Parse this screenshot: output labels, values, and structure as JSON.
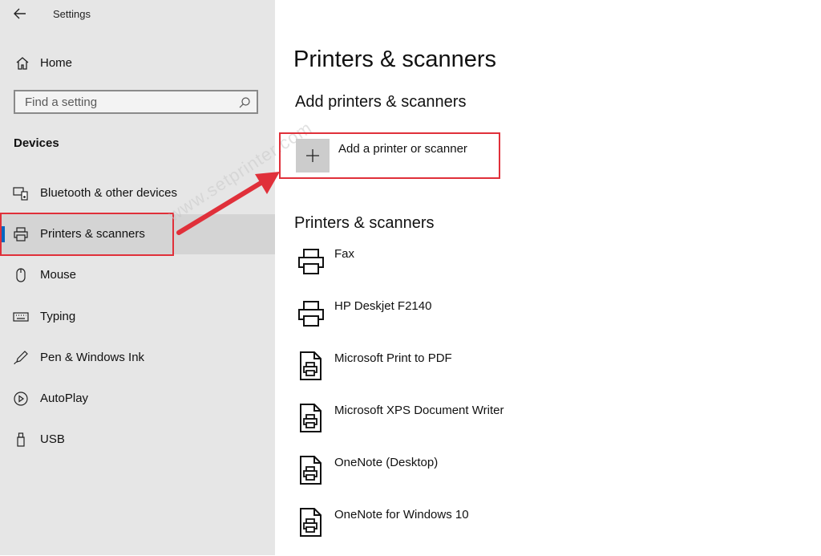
{
  "window": {
    "title": "Settings"
  },
  "sidebar": {
    "home_label": "Home",
    "search_placeholder": "Find a setting",
    "section": "Devices",
    "items": [
      {
        "label": "Bluetooth & other devices",
        "icon": "bluetooth-devices-icon"
      },
      {
        "label": "Printers & scanners",
        "icon": "printer-icon",
        "selected": true
      },
      {
        "label": "Mouse",
        "icon": "mouse-icon"
      },
      {
        "label": "Typing",
        "icon": "keyboard-icon"
      },
      {
        "label": "Pen & Windows Ink",
        "icon": "pen-icon"
      },
      {
        "label": "AutoPlay",
        "icon": "autoplay-icon"
      },
      {
        "label": "USB",
        "icon": "usb-icon"
      }
    ]
  },
  "main": {
    "title": "Printers & scanners",
    "add_section_title": "Add printers & scanners",
    "add_button_label": "Add a printer or scanner",
    "list_title": "Printers & scanners",
    "printers": [
      {
        "name": "Fax",
        "icon": "printer-icon"
      },
      {
        "name": "HP Deskjet F2140",
        "icon": "printer-icon"
      },
      {
        "name": "Microsoft Print to PDF",
        "icon": "document-printer-icon"
      },
      {
        "name": "Microsoft XPS Document Writer",
        "icon": "document-printer-icon"
      },
      {
        "name": "OneNote (Desktop)",
        "icon": "document-printer-icon"
      },
      {
        "name": "OneNote for Windows 10",
        "icon": "document-printer-icon"
      }
    ]
  },
  "watermark": "www.setprinter.com",
  "colors": {
    "highlight": "#e0303a",
    "accent": "#0067c0",
    "sidebar_bg": "#e6e6e6"
  }
}
